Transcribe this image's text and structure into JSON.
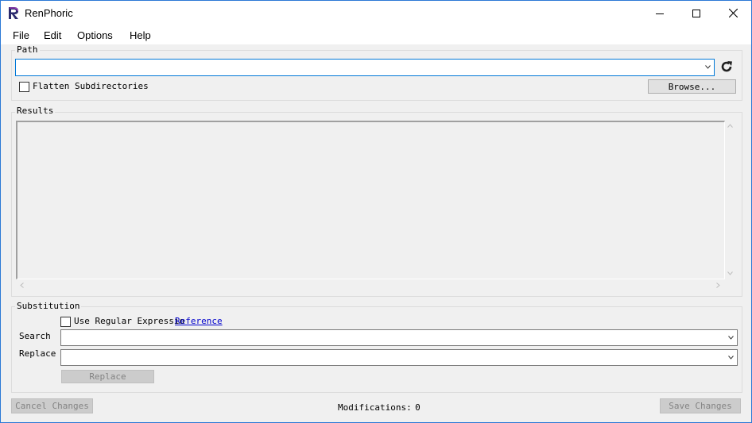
{
  "window": {
    "title": "RenPhoric"
  },
  "menu": [
    "File",
    "Edit",
    "Options",
    "Help"
  ],
  "path": {
    "label": "Path",
    "value": "",
    "flatten_label": "Flatten Subdirectories",
    "flatten_checked": false,
    "browse_label": "Browse..."
  },
  "results": {
    "label": "Results"
  },
  "substitution": {
    "label": "Substitution",
    "regex_label": "Use Regular Expressio",
    "reference_link": "Reference",
    "regex_checked": false,
    "search_label": "Search",
    "search_value": "",
    "replace_label": "Replace",
    "replace_value": "",
    "replace_button": "Replace"
  },
  "footer": {
    "cancel_label": "Cancel Changes",
    "modifications_label": "Modifications:",
    "modifications_count": "0",
    "save_label": "Save Changes"
  },
  "colors": {
    "accent": "#0078d7",
    "link": "#0000cc",
    "icon": "#7a3fd1"
  }
}
